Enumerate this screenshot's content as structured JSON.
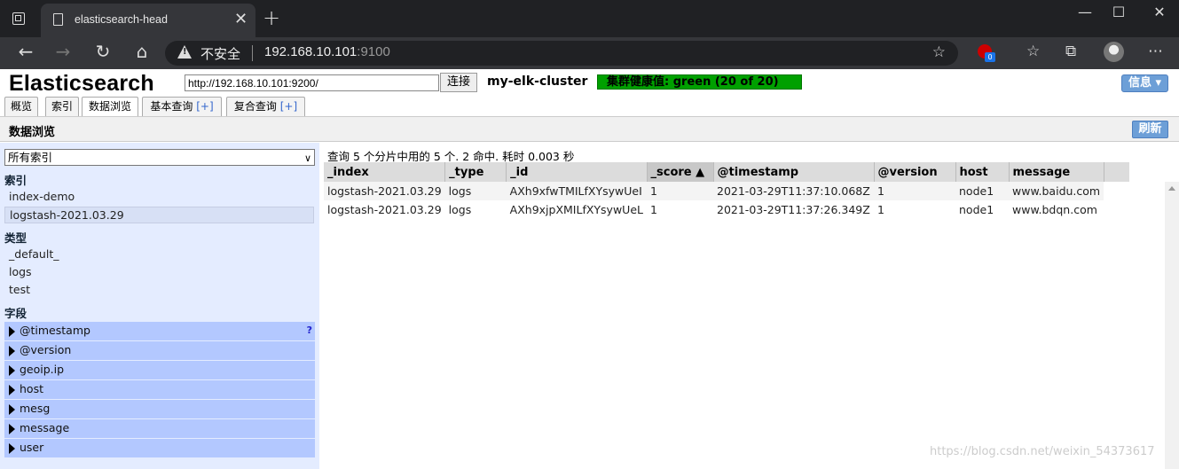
{
  "browser": {
    "tab_title": "elasticsearch-head",
    "tab_close": "✕",
    "new_tab": "+",
    "security_label": "不安全",
    "url_host": "192.168.10.101",
    "url_port": ":9100",
    "ext_badge": "0"
  },
  "app": {
    "logo": "Elasticsearch",
    "connect_url": "http://192.168.10.101:9200/",
    "connect_button": "连接",
    "cluster_name": "my-elk-cluster",
    "health": "集群健康值: green (20 of 20)",
    "health_color": "#00a000",
    "info_button": "信息 ▾",
    "tabs": [
      {
        "label": "概览"
      },
      {
        "label": "索引"
      },
      {
        "label": "数据浏览"
      },
      {
        "label": "基本查询",
        "plus": "[+]"
      },
      {
        "label": "复合查询",
        "plus": "[+]"
      }
    ],
    "section_title": "数据浏览",
    "refresh_button": "刷新"
  },
  "sidebar": {
    "index_select": "所有索引",
    "indices_header": "索引",
    "indices": [
      "index-demo",
      "logstash-2021.03.29"
    ],
    "types_header": "类型",
    "types": [
      "_default_",
      "logs",
      "test"
    ],
    "fields_header": "字段",
    "fields": [
      "@timestamp",
      "@version",
      "geoip.ip",
      "host",
      "mesg",
      "message",
      "user"
    ],
    "help_mark": "?"
  },
  "main": {
    "query_info": "查询 5 个分片中用的 5 个. 2 命中. 耗时 0.003 秒",
    "columns": [
      "_index",
      "_type",
      "_id",
      "_score ▲",
      "@timestamp",
      "@version",
      "host",
      "message"
    ],
    "rows": [
      [
        "logstash-2021.03.29",
        "logs",
        "AXh9xfwTMILfXYsywUeI",
        "1",
        "2021-03-29T11:37:10.068Z",
        "1",
        "node1",
        "www.baidu.com"
      ],
      [
        "logstash-2021.03.29",
        "logs",
        "AXh9xjpXMILfXYsywUeL",
        "1",
        "2021-03-29T11:37:26.349Z",
        "1",
        "node1",
        "www.bdqn.com"
      ]
    ]
  },
  "watermark": "https://blog.csdn.net/weixin_54373617"
}
